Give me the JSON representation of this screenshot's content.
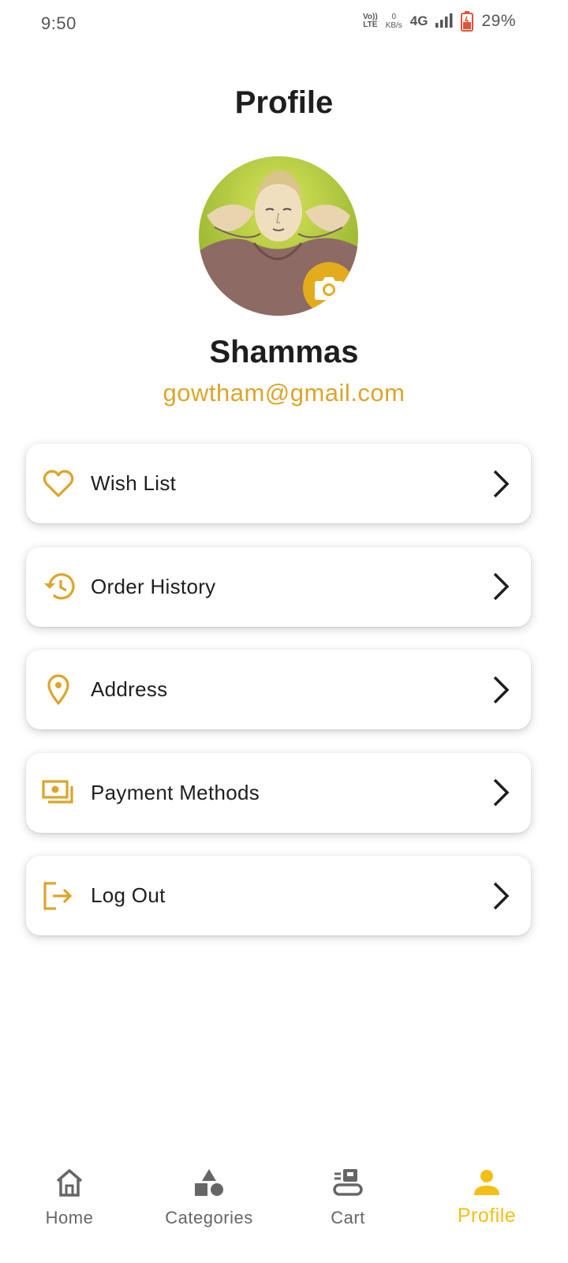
{
  "status_bar": {
    "time": "9:50",
    "volte_top": "Vo))",
    "volte_bottom": "LTE",
    "kbs_value": "0",
    "kbs_unit": "KB/s",
    "network": "4G",
    "battery_percent": "29%"
  },
  "header": {
    "title": "Profile"
  },
  "profile": {
    "name": "Shammas",
    "email": "gowtham@gmail.com"
  },
  "menu": {
    "items": [
      {
        "label": "Wish List",
        "icon": "heart-icon"
      },
      {
        "label": "Order History",
        "icon": "history-icon"
      },
      {
        "label": "Address",
        "icon": "location-pin-icon"
      },
      {
        "label": "Payment Methods",
        "icon": "payments-icon"
      },
      {
        "label": "Log Out",
        "icon": "logout-icon"
      }
    ]
  },
  "bottom_nav": {
    "items": [
      {
        "label": "Home",
        "icon": "home-icon"
      },
      {
        "label": "Categories",
        "icon": "categories-icon"
      },
      {
        "label": "Cart",
        "icon": "cart-icon"
      },
      {
        "label": "Profile",
        "icon": "person-icon"
      }
    ],
    "active_index": 3
  },
  "colors": {
    "accent": "#DCA52A",
    "active_nav": "#F2BF16",
    "text": "#1E1E1E"
  }
}
